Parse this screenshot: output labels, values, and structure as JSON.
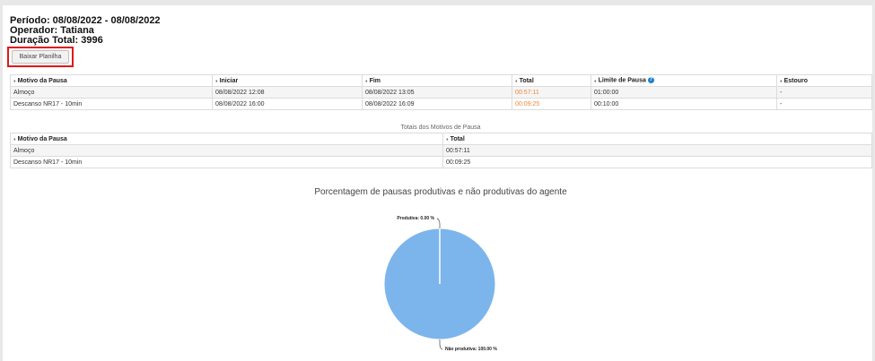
{
  "summary": {
    "periodo": "Período: 08/08/2022 - 08/08/2022",
    "operador": "Operador: Tatiana",
    "duracao": "Duração Total: 3996"
  },
  "toolbar": {
    "download_label": "Baixar Planilha"
  },
  "pauses_table": {
    "headers": [
      "Motivo da Pausa",
      "Iniciar",
      "Fim",
      "Total",
      "Limite de Pausa",
      "Estouro"
    ],
    "rows": [
      [
        "Almoço",
        "08/08/2022 12:08",
        "08/08/2022 13:05",
        "00:57:11",
        "01:00:00",
        "-"
      ],
      [
        "Descanso NR17 - 10min",
        "08/08/2022 16:00",
        "08/08/2022 16:09",
        "00:09:25",
        "00:10:00",
        "-"
      ]
    ]
  },
  "totals_table": {
    "title": "Totais dos Motivos de Pausa",
    "headers": [
      "Motivo da Pausa",
      "Total"
    ],
    "rows": [
      [
        "Almoço",
        "00:57:11"
      ],
      [
        "Descanso NR17 - 10min",
        "00:09:25"
      ]
    ]
  },
  "colors": {
    "over_time": "#f0883a",
    "pie_fill": "#7cb5ec",
    "highlight_border": "#e01818"
  },
  "chart_data": {
    "type": "pie",
    "title": "Porcentagem de pausas produtivas e não produtivas do agente",
    "slices": [
      {
        "label": "Produtiva",
        "value": 0.0
      },
      {
        "label": "Não produtiva",
        "value": 100.0
      }
    ],
    "data_labels": [
      "Produtiva: 0.00 %",
      "Não produtiva: 100.00 %"
    ]
  }
}
